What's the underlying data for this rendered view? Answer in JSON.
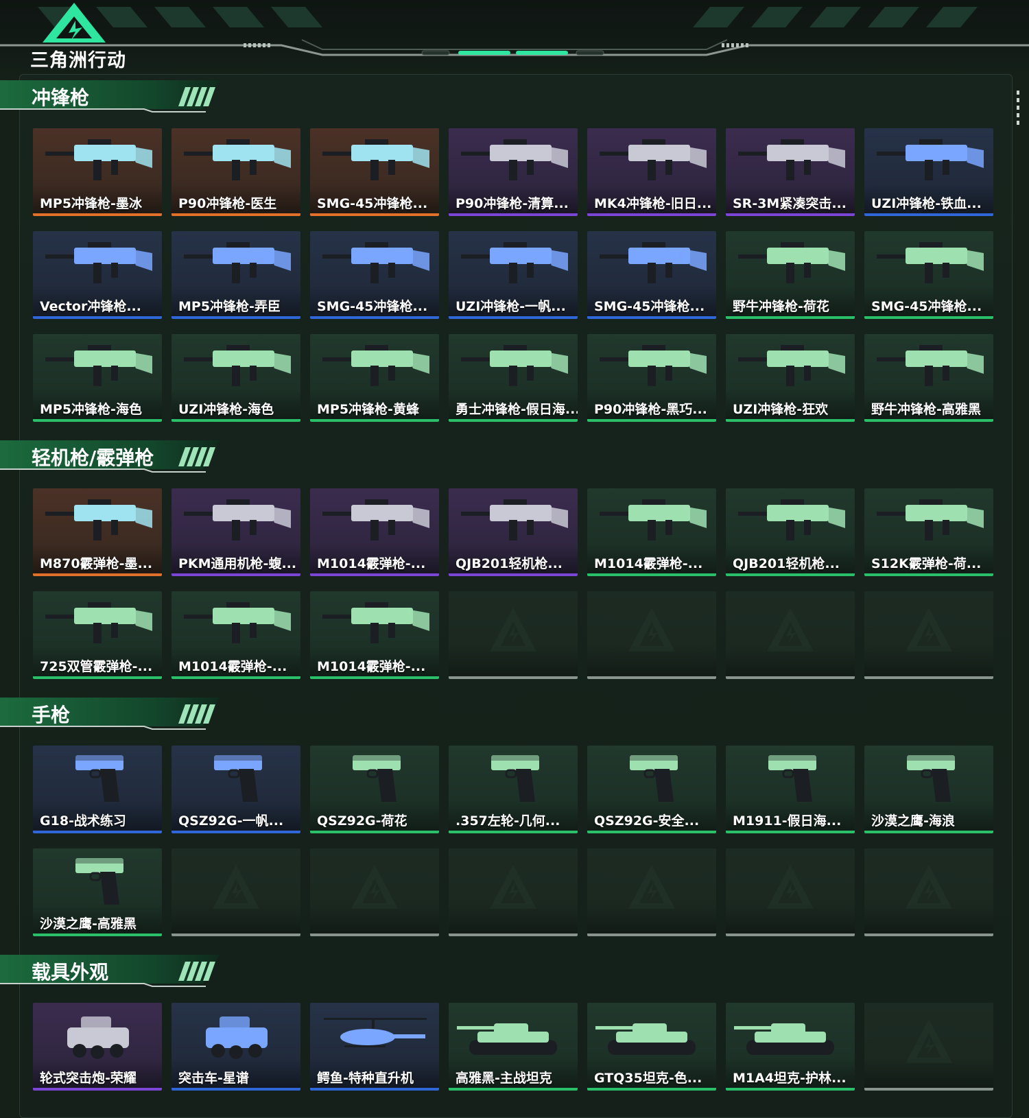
{
  "brand": {
    "logo_text": "三角洲行动"
  },
  "colors": {
    "orange": "#e0702a",
    "purple": "#7b45d6",
    "blue": "#2f66d8",
    "green": "#2ac06a",
    "accent": "#2ee6a0"
  },
  "sections": [
    {
      "title": "冲锋枪",
      "items": [
        {
          "name": "MP5冲锋枪-墨冰",
          "rarity": "orange",
          "icon": "smg-icon"
        },
        {
          "name": "P90冲锋枪-医生",
          "rarity": "orange",
          "icon": "smg-icon"
        },
        {
          "name": "SMG-45冲锋枪...",
          "rarity": "orange",
          "icon": "smg-icon"
        },
        {
          "name": "P90冲锋枪-清算...",
          "rarity": "purple",
          "icon": "smg-icon"
        },
        {
          "name": "MK4冲锋枪-旧日...",
          "rarity": "purple",
          "icon": "smg-icon"
        },
        {
          "name": "SR-3M紧凑突击...",
          "rarity": "purple",
          "icon": "smg-icon"
        },
        {
          "name": "UZI冲锋枪-铁血...",
          "rarity": "blue",
          "icon": "smg-icon"
        },
        {
          "name": "Vector冲锋枪...",
          "rarity": "blue",
          "icon": "smg-icon"
        },
        {
          "name": "MP5冲锋枪-弄臣",
          "rarity": "blue",
          "icon": "smg-icon"
        },
        {
          "name": "SMG-45冲锋枪...",
          "rarity": "blue",
          "icon": "smg-icon"
        },
        {
          "name": "UZI冲锋枪-一帆...",
          "rarity": "blue",
          "icon": "smg-icon"
        },
        {
          "name": "SMG-45冲锋枪...",
          "rarity": "blue",
          "icon": "smg-icon"
        },
        {
          "name": "野牛冲锋枪-荷花",
          "rarity": "green",
          "icon": "smg-icon"
        },
        {
          "name": "SMG-45冲锋枪...",
          "rarity": "green",
          "icon": "smg-icon"
        },
        {
          "name": "MP5冲锋枪-海色",
          "rarity": "green",
          "icon": "smg-icon"
        },
        {
          "name": "UZI冲锋枪-海色",
          "rarity": "green",
          "icon": "smg-icon"
        },
        {
          "name": "MP5冲锋枪-黄蜂",
          "rarity": "green",
          "icon": "smg-icon"
        },
        {
          "name": "勇士冲锋枪-假日海...",
          "rarity": "green",
          "icon": "smg-icon"
        },
        {
          "name": "P90冲锋枪-黑巧...",
          "rarity": "green",
          "icon": "smg-icon"
        },
        {
          "name": "UZI冲锋枪-狂欢",
          "rarity": "green",
          "icon": "smg-icon"
        },
        {
          "name": "野牛冲锋枪-高雅黑",
          "rarity": "green",
          "icon": "smg-icon"
        }
      ]
    },
    {
      "title": "轻机枪/霰弹枪",
      "items": [
        {
          "name": "M870霰弹枪-墨...",
          "rarity": "orange",
          "icon": "shotgun-icon"
        },
        {
          "name": "PKM通用机枪-蝮...",
          "rarity": "purple",
          "icon": "lmg-icon"
        },
        {
          "name": "M1014霰弹枪-...",
          "rarity": "purple",
          "icon": "shotgun-icon"
        },
        {
          "name": "QJB201轻机枪...",
          "rarity": "purple",
          "icon": "lmg-icon"
        },
        {
          "name": "M1014霰弹枪-...",
          "rarity": "green",
          "icon": "shotgun-icon"
        },
        {
          "name": "QJB201轻机枪...",
          "rarity": "green",
          "icon": "lmg-icon"
        },
        {
          "name": "S12K霰弹枪-荷...",
          "rarity": "green",
          "icon": "shotgun-icon"
        },
        {
          "name": "725双管霰弹枪-...",
          "rarity": "green",
          "icon": "shotgun-icon"
        },
        {
          "name": "M1014霰弹枪-...",
          "rarity": "green",
          "icon": "shotgun-icon"
        },
        {
          "name": "M1014霰弹枪-...",
          "rarity": "green",
          "icon": "shotgun-icon"
        },
        {
          "name": "",
          "rarity": "empty",
          "icon": "placeholder-logo-icon"
        },
        {
          "name": "",
          "rarity": "empty",
          "icon": "placeholder-logo-icon"
        },
        {
          "name": "",
          "rarity": "empty",
          "icon": "placeholder-logo-icon"
        },
        {
          "name": "",
          "rarity": "empty",
          "icon": "placeholder-logo-icon"
        }
      ]
    },
    {
      "title": "手枪",
      "items": [
        {
          "name": "G18-战术练习",
          "rarity": "blue",
          "icon": "pistol-icon"
        },
        {
          "name": "QSZ92G-一帆...",
          "rarity": "blue",
          "icon": "pistol-icon"
        },
        {
          "name": "QSZ92G-荷花",
          "rarity": "green",
          "icon": "pistol-icon"
        },
        {
          "name": ".357左轮-几何...",
          "rarity": "green",
          "icon": "revolver-icon"
        },
        {
          "name": "QSZ92G-安全...",
          "rarity": "green",
          "icon": "pistol-icon"
        },
        {
          "name": "M1911-假日海...",
          "rarity": "green",
          "icon": "pistol-icon"
        },
        {
          "name": "沙漠之鹰-海浪",
          "rarity": "green",
          "icon": "pistol-icon"
        },
        {
          "name": "沙漠之鹰-高雅黑",
          "rarity": "green",
          "icon": "pistol-icon"
        },
        {
          "name": "",
          "rarity": "empty",
          "icon": "placeholder-logo-icon"
        },
        {
          "name": "",
          "rarity": "empty",
          "icon": "placeholder-logo-icon"
        },
        {
          "name": "",
          "rarity": "empty",
          "icon": "placeholder-logo-icon"
        },
        {
          "name": "",
          "rarity": "empty",
          "icon": "placeholder-logo-icon"
        },
        {
          "name": "",
          "rarity": "empty",
          "icon": "placeholder-logo-icon"
        },
        {
          "name": "",
          "rarity": "empty",
          "icon": "placeholder-logo-icon"
        }
      ]
    },
    {
      "title": "载具外观",
      "items": [
        {
          "name": "轮式突击炮-荣耀",
          "rarity": "purple",
          "icon": "vehicle-icon"
        },
        {
          "name": "突击车-星谱",
          "rarity": "blue",
          "icon": "vehicle-icon"
        },
        {
          "name": "鳄鱼-特种直升机",
          "rarity": "blue",
          "icon": "helicopter-icon"
        },
        {
          "name": "高雅黑-主战坦克",
          "rarity": "green",
          "icon": "tank-icon"
        },
        {
          "name": "GTQ35坦克-色...",
          "rarity": "green",
          "icon": "tank-icon"
        },
        {
          "name": "M1A4坦克-护林...",
          "rarity": "green",
          "icon": "tank-icon"
        },
        {
          "name": "",
          "rarity": "empty",
          "icon": "placeholder-logo-icon"
        }
      ]
    }
  ]
}
